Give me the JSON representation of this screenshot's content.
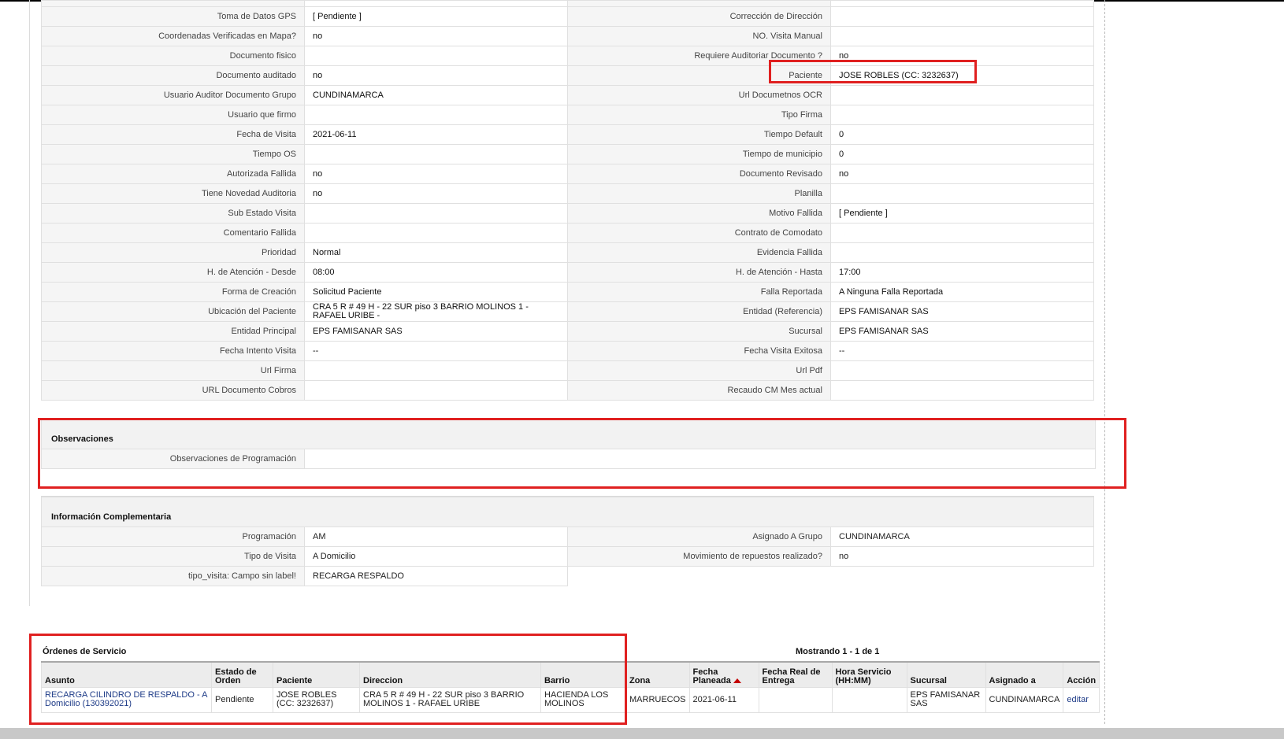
{
  "details": [
    {
      "l1": "Toma de Datos GPS",
      "v1": "[ Pendiente ]",
      "l2": "Corrección de Dirección",
      "v2": ""
    },
    {
      "l1": "Coordenadas Verificadas en Mapa?",
      "v1": "no",
      "l2": "NO. Visita Manual",
      "v2": ""
    },
    {
      "l1": "Documento fisico",
      "v1": "",
      "l2": "Requiere Auditoriar Documento ?",
      "v2": "no"
    },
    {
      "l1": "Documento auditado",
      "v1": "no",
      "l2": "Paciente",
      "v2": "JOSE ROBLES (CC: 3232637)"
    },
    {
      "l1": "Usuario Auditor Documento Grupo",
      "v1": "CUNDINAMARCA",
      "l2": "Url Documetnos OCR",
      "v2": ""
    },
    {
      "l1": "Usuario que firmo",
      "v1": "",
      "l2": "Tipo Firma",
      "v2": ""
    },
    {
      "l1": "Fecha de Visita",
      "v1": "2021-06-11",
      "l2": "Tiempo Default",
      "v2": "0"
    },
    {
      "l1": "Tiempo OS",
      "v1": "",
      "l2": "Tiempo de municipio",
      "v2": "0"
    },
    {
      "l1": "Autorizada Fallida",
      "v1": "no",
      "l2": "Documento Revisado",
      "v2": "no"
    },
    {
      "l1": "Tiene Novedad Auditoria",
      "v1": "no",
      "l2": "Planilla",
      "v2": ""
    },
    {
      "l1": "Sub Estado Visita",
      "v1": "",
      "l2": "Motivo Fallida",
      "v2": "[ Pendiente ]"
    },
    {
      "l1": "Comentario Fallida",
      "v1": "",
      "l2": "Contrato de Comodato",
      "v2": ""
    },
    {
      "l1": "Prioridad",
      "v1": "Normal",
      "l2": "Evidencia Fallida",
      "v2": ""
    },
    {
      "l1": "H. de Atención - Desde",
      "v1": "08:00",
      "l2": "H. de Atención - Hasta",
      "v2": "17:00"
    },
    {
      "l1": "Forma de Creación",
      "v1": "Solicitud Paciente",
      "l2": "Falla Reportada",
      "v2": "A Ninguna Falla Reportada"
    },
    {
      "l1": "Ubicación del Paciente",
      "v1": "CRA 5 R # 49 H - 22 SUR piso 3 BARRIO MOLINOS 1 - RAFAEL URIBE -",
      "l2": "Entidad (Referencia)",
      "v2": "EPS FAMISANAR SAS"
    },
    {
      "l1": "Entidad Principal",
      "v1": "EPS FAMISANAR SAS",
      "l2": "Sucursal",
      "v2": "EPS FAMISANAR SAS"
    },
    {
      "l1": "Fecha Intento Visita",
      "v1": "--",
      "l2": "Fecha Visita Exitosa",
      "v2": "--"
    },
    {
      "l1": "Url Firma",
      "v1": "",
      "l2": "Url Pdf",
      "v2": ""
    },
    {
      "l1": "URL Documento Cobros",
      "v1": "",
      "l2": "Recaudo CM Mes actual",
      "v2": ""
    }
  ],
  "observaciones": {
    "title": "Observaciones",
    "label": "Observaciones de Programación",
    "value": ""
  },
  "complementaria": {
    "title": "Información Complementaria",
    "rows": [
      {
        "l1": "Programación",
        "v1": "AM",
        "l2": "Asignado A Grupo",
        "v2": "CUNDINAMARCA"
      },
      {
        "l1": "Tipo de Visita",
        "v1": "A Domicilio",
        "l2": "Movimiento de repuestos realizado?",
        "v2": "no"
      },
      {
        "l1": "tipo_visita: Campo sin label!",
        "v1": "RECARGA RESPALDO"
      }
    ]
  },
  "orders": {
    "title": "Órdenes de Servicio",
    "paging": "Mostrando 1 - 1 de 1",
    "columns": {
      "asunto": "Asunto",
      "estado": "Estado de Orden",
      "paciente": "Paciente",
      "direccion": "Direccion",
      "barrio": "Barrio",
      "zona": "Zona",
      "fecha_planeada": "Fecha Planeada",
      "fecha_real": "Fecha Real de Entrega",
      "hora": "Hora Servicio (HH:MM)",
      "sucursal": "Sucursal",
      "asignado": "Asignado a",
      "accion": "Acción"
    },
    "rows": [
      {
        "asunto": "RECARGA CILINDRO DE RESPALDO - A Domicilio (130392021)",
        "estado": "Pendiente",
        "paciente": "JOSE ROBLES (CC: 3232637)",
        "direccion": "CRA 5 R # 49 H - 22 SUR piso 3 BARRIO MOLINOS 1 - RAFAEL URIBE",
        "barrio": "HACIENDA LOS MOLINOS",
        "zona": "MARRUECOS",
        "fecha_planeada": "2021-06-11",
        "fecha_real": "",
        "hora": "",
        "sucursal": "EPS FAMISANAR SAS",
        "asignado": "CUNDINAMARCA",
        "accion": "editar"
      }
    ]
  },
  "colors": {
    "highlight_box": "#e02020",
    "label_bg": "#f5f5f5",
    "link": "#1f3c88",
    "sort_arrow": "#c40000"
  }
}
